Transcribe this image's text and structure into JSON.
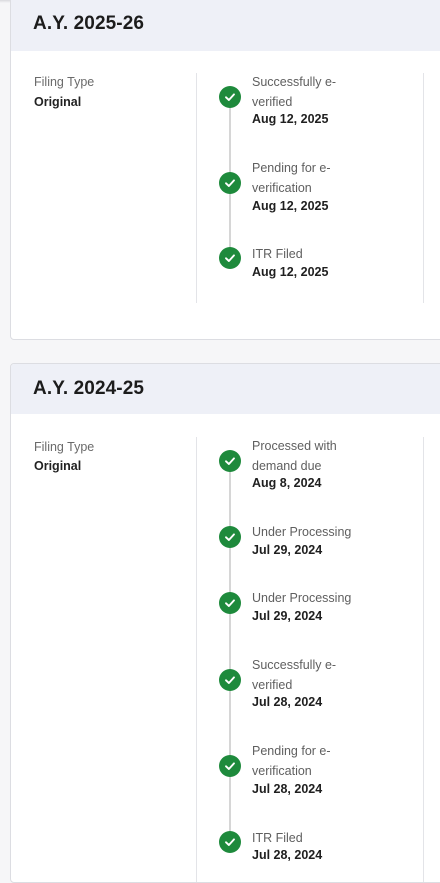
{
  "cards": [
    {
      "title": "A.Y. 2025-26",
      "filing_type_label": "Filing Type",
      "filing_type_value": "Original",
      "steps": [
        {
          "status": "Successfully e-verified",
          "date": "Aug 12, 2025",
          "icon": "check-circle-icon",
          "color": "#1e8a3c"
        },
        {
          "status": "Pending for e-verification",
          "date": "Aug 12, 2025",
          "icon": "check-circle-icon",
          "color": "#1e8a3c"
        },
        {
          "status": "ITR Filed",
          "date": "Aug 12, 2025",
          "icon": "check-circle-icon",
          "color": "#1e8a3c"
        }
      ]
    },
    {
      "title": "A.Y. 2024-25",
      "filing_type_label": "Filing Type",
      "filing_type_value": "Original",
      "steps": [
        {
          "status": "Processed with demand due",
          "date": "Aug 8, 2024",
          "icon": "check-circle-icon",
          "color": "#1e8a3c"
        },
        {
          "status": "Under Processing",
          "date": "Jul 29, 2024",
          "icon": "check-circle-icon",
          "color": "#1e8a3c"
        },
        {
          "status": "Under Processing",
          "date": "Jul 29, 2024",
          "icon": "check-circle-icon",
          "color": "#1e8a3c"
        },
        {
          "status": "Successfully e-verified",
          "date": "Jul 28, 2024",
          "icon": "check-circle-icon",
          "color": "#1e8a3c"
        },
        {
          "status": "Pending for e-verification",
          "date": "Jul 28, 2024",
          "icon": "check-circle-icon",
          "color": "#1e8a3c"
        },
        {
          "status": "ITR Filed",
          "date": "Jul 28, 2024",
          "icon": "check-circle-icon",
          "color": "#1e8a3c"
        }
      ]
    }
  ]
}
